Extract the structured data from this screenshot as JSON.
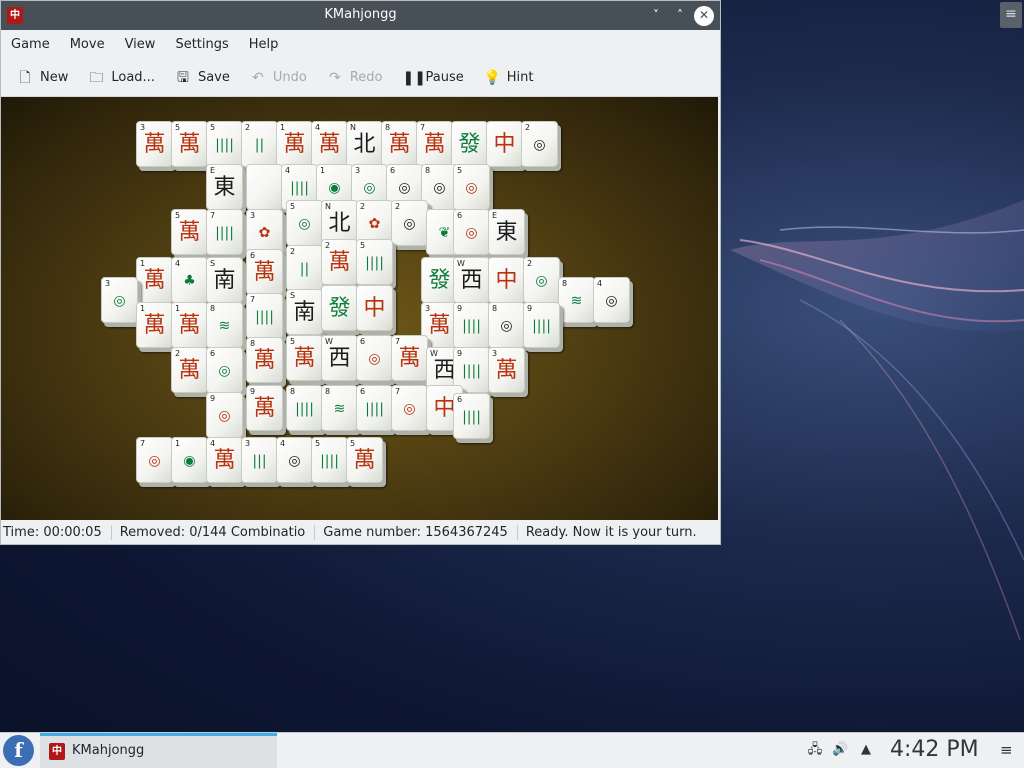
{
  "window": {
    "title": "KMahjongg",
    "app_icon": "mahjong-tile-icon",
    "controls": {
      "minimize": "˅",
      "maximize": "˄",
      "close": "✕"
    }
  },
  "menubar": [
    "Game",
    "Move",
    "View",
    "Settings",
    "Help"
  ],
  "toolbar": {
    "new": "New",
    "load": "Load...",
    "save": "Save",
    "undo": "Undo",
    "redo": "Redo",
    "pause": "Pause",
    "hint": "Hint"
  },
  "statusbar": {
    "time": "Time: 00:00:05",
    "removed": "Removed: 0/144  Combinatio",
    "game_number": "Game number: 1564367245",
    "message": "Ready. Now it is your turn."
  },
  "taskbar": {
    "start_glyph": "f",
    "task_label": "KMahjongg",
    "clock": "4:42 PM"
  },
  "board": {
    "tiles": [
      {
        "n": "3",
        "g": "萬",
        "c": "red"
      },
      {
        "n": "5",
        "g": "萬",
        "c": "red"
      },
      {
        "n": "5",
        "g": "||||",
        "c": "green"
      },
      {
        "n": "2",
        "g": "||",
        "c": "green"
      },
      {
        "n": "1",
        "g": "萬",
        "c": "red"
      },
      {
        "n": "4",
        "g": "萬",
        "c": "red"
      },
      {
        "n": "N",
        "g": "北",
        "c": "black"
      },
      {
        "n": "8",
        "g": "萬",
        "c": "red"
      },
      {
        "n": "7",
        "g": "萬",
        "c": "red"
      },
      {
        "n": "",
        "g": "發",
        "c": "green"
      },
      {
        "n": "",
        "g": "中",
        "c": "red"
      },
      {
        "n": "2",
        "g": "◎",
        "c": "black"
      },
      {
        "n": "E",
        "g": "東",
        "c": "black"
      },
      {
        "n": "",
        "g": "",
        "c": "black"
      },
      {
        "n": "4",
        "g": "||||",
        "c": "green"
      },
      {
        "n": "1",
        "g": "◉",
        "c": "green"
      },
      {
        "n": "3",
        "g": "◎",
        "c": "green"
      },
      {
        "n": "6",
        "g": "◎",
        "c": "black"
      },
      {
        "n": "8",
        "g": "◎",
        "c": "black"
      },
      {
        "n": "5",
        "g": "◎",
        "c": "red"
      },
      {
        "n": "5",
        "g": "萬",
        "c": "red"
      },
      {
        "n": "7",
        "g": "||||",
        "c": "green"
      },
      {
        "n": "3",
        "g": "✿",
        "c": "red"
      },
      {
        "n": "5",
        "g": "◎",
        "c": "green"
      },
      {
        "n": "N",
        "g": "北",
        "c": "black"
      },
      {
        "n": "2",
        "g": "✿",
        "c": "red"
      },
      {
        "n": "2",
        "g": "◎",
        "c": "black"
      },
      {
        "n": "",
        "g": "❦",
        "c": "green"
      },
      {
        "n": "6",
        "g": "◎",
        "c": "red"
      },
      {
        "n": "E",
        "g": "東",
        "c": "black"
      },
      {
        "n": "1",
        "g": "萬",
        "c": "red"
      },
      {
        "n": "4",
        "g": "♣",
        "c": "green"
      },
      {
        "n": "S",
        "g": "南",
        "c": "black"
      },
      {
        "n": "6",
        "g": "萬",
        "c": "red"
      },
      {
        "n": "2",
        "g": "||",
        "c": "green"
      },
      {
        "n": "2",
        "g": "萬",
        "c": "red"
      },
      {
        "n": "5",
        "g": "||||",
        "c": "green"
      },
      {
        "n": "",
        "g": "發",
        "c": "green"
      },
      {
        "n": "W",
        "g": "西",
        "c": "black"
      },
      {
        "n": "",
        "g": "中",
        "c": "red"
      },
      {
        "n": "2",
        "g": "◎",
        "c": "green"
      },
      {
        "n": "8",
        "g": "≋",
        "c": "green"
      },
      {
        "n": "4",
        "g": "◎",
        "c": "black"
      },
      {
        "n": "3",
        "g": "◎",
        "c": "green"
      },
      {
        "n": "1",
        "g": "萬",
        "c": "red"
      },
      {
        "n": "1",
        "g": "萬",
        "c": "red"
      },
      {
        "n": "8",
        "g": "≋",
        "c": "green"
      },
      {
        "n": "7",
        "g": "||||",
        "c": "green"
      },
      {
        "n": "S",
        "g": "南",
        "c": "black"
      },
      {
        "n": "",
        "g": "發",
        "c": "green"
      },
      {
        "n": "",
        "g": "中",
        "c": "red"
      },
      {
        "n": "3",
        "g": "萬",
        "c": "red"
      },
      {
        "n": "9",
        "g": "||||",
        "c": "green"
      },
      {
        "n": "8",
        "g": "◎",
        "c": "black"
      },
      {
        "n": "9",
        "g": "||||",
        "c": "green"
      },
      {
        "n": "2",
        "g": "萬",
        "c": "red"
      },
      {
        "n": "6",
        "g": "◎",
        "c": "green"
      },
      {
        "n": "8",
        "g": "萬",
        "c": "red"
      },
      {
        "n": "5",
        "g": "萬",
        "c": "red"
      },
      {
        "n": "W",
        "g": "西",
        "c": "black"
      },
      {
        "n": "6",
        "g": "◎",
        "c": "red"
      },
      {
        "n": "7",
        "g": "萬",
        "c": "red"
      },
      {
        "n": "W",
        "g": "西",
        "c": "black"
      },
      {
        "n": "9",
        "g": "||||",
        "c": "green"
      },
      {
        "n": "3",
        "g": "萬",
        "c": "red"
      },
      {
        "n": "9",
        "g": "◎",
        "c": "red"
      },
      {
        "n": "9",
        "g": "萬",
        "c": "red"
      },
      {
        "n": "8",
        "g": "||||",
        "c": "green"
      },
      {
        "n": "8",
        "g": "≋",
        "c": "green"
      },
      {
        "n": "6",
        "g": "||||",
        "c": "green"
      },
      {
        "n": "7",
        "g": "◎",
        "c": "red"
      },
      {
        "n": "",
        "g": "中",
        "c": "red"
      },
      {
        "n": "6",
        "g": "||||",
        "c": "green"
      },
      {
        "n": "7",
        "g": "◎",
        "c": "red"
      },
      {
        "n": "1",
        "g": "◉",
        "c": "green"
      },
      {
        "n": "4",
        "g": "萬",
        "c": "red"
      },
      {
        "n": "3",
        "g": "|||",
        "c": "green"
      },
      {
        "n": "4",
        "g": "◎",
        "c": "black"
      },
      {
        "n": "5",
        "g": "||||",
        "c": "green"
      },
      {
        "n": "5",
        "g": "萬",
        "c": "red"
      }
    ]
  },
  "colors": {
    "titlebar": "#475057",
    "accent": "#3daee9",
    "tile_red": "#b8320f",
    "tile_green": "#0b7b3a"
  }
}
